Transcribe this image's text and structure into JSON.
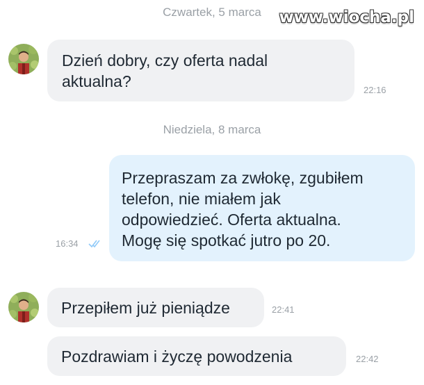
{
  "watermark": "www.wiocha.pl",
  "messages": {
    "date1": "Czwartek, 5 marca",
    "m1": {
      "line1": "Dzień dobry, czy oferta nadal",
      "line2": "aktualna?",
      "time": "22:16"
    },
    "date2": "Niedziela, 8 marca",
    "m2": {
      "line1": "Przepraszam za zwłokę, zgubiłem",
      "line2": "telefon, nie miałem jak",
      "line3": "odpowiedzieć. Oferta aktualna.",
      "line4": "Mogę się spotkać jutro po 20.",
      "time": "16:34",
      "status_icon": "double-check-icon"
    },
    "m3": {
      "text": "Przepiłem już pieniądze",
      "time": "22:41"
    },
    "m4": {
      "text": "Pozdrawiam i życzę powodzenia",
      "time": "22:42"
    }
  },
  "colors": {
    "incoming_bubble": "#f0f1f3",
    "outgoing_bubble": "#e3f2fd",
    "timestamp": "#9aa0a6",
    "read_ticks": "#90caf9"
  }
}
